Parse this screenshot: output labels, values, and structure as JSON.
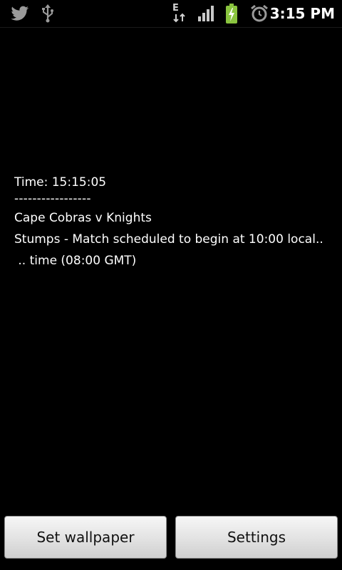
{
  "status_bar": {
    "time": "3:15 PM",
    "network_type_letter": "E",
    "icons": [
      "twitter-icon",
      "usb-icon",
      "network-type-icon",
      "signal-icon",
      "battery-charging-icon",
      "alarm-icon"
    ],
    "battery_color": "#8ac43f"
  },
  "wallpaper_preview": {
    "time_line": "Time: 15:15:05",
    "divider": "-----------------",
    "match_title": "Cape Cobras v Knights",
    "status_line_1": "Stumps - Match scheduled to begin at 10:00 local..",
    "status_line_2": " .. time (08:00 GMT)"
  },
  "buttons": {
    "set_wallpaper": "Set wallpaper",
    "settings": "Settings"
  }
}
